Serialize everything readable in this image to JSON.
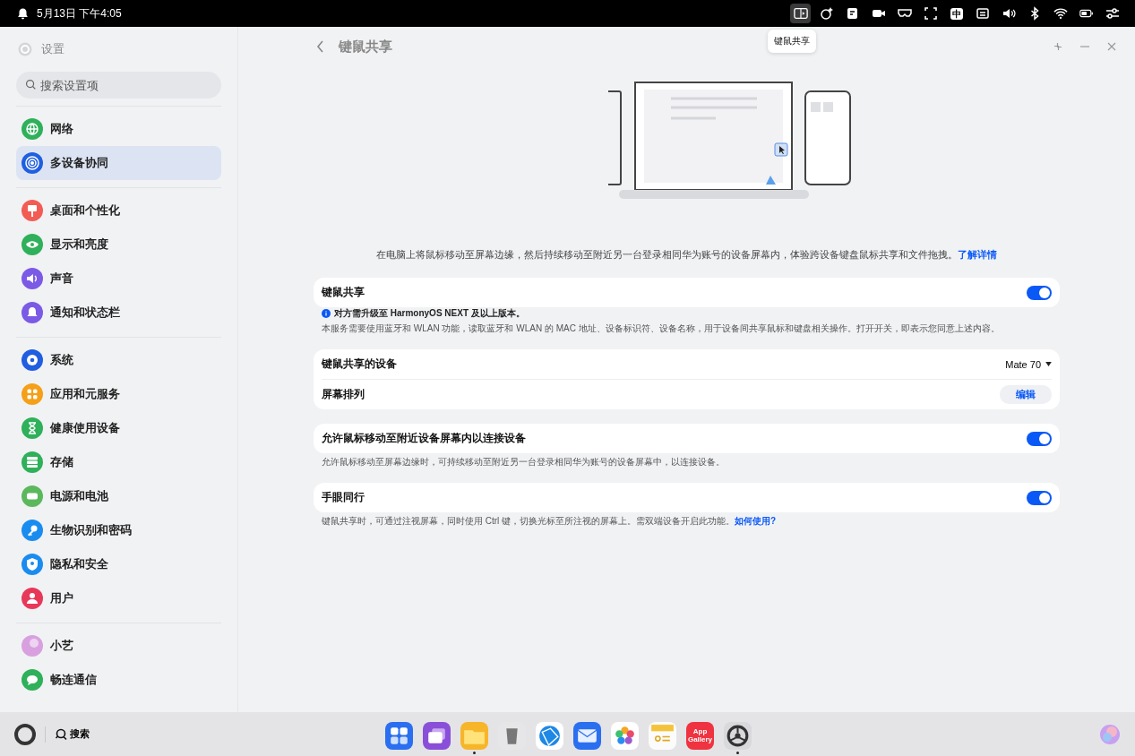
{
  "status_bar": {
    "date_time": "5月13日 下午4:05",
    "tray": [
      {
        "kind": "share",
        "selected": true
      },
      {
        "kind": "sparkle",
        "selected": false
      },
      {
        "kind": "note",
        "selected": false
      },
      {
        "kind": "camera",
        "selected": false
      },
      {
        "kind": "glasses",
        "selected": false
      },
      {
        "kind": "frame",
        "selected": false
      },
      {
        "kind": "ime",
        "label": "中",
        "selected": false
      },
      {
        "kind": "ticket",
        "selected": false
      },
      {
        "kind": "volume",
        "selected": false
      },
      {
        "kind": "bluetooth",
        "selected": false
      },
      {
        "kind": "wifi",
        "selected": false
      },
      {
        "kind": "battery",
        "selected": false
      },
      {
        "kind": "sliders",
        "selected": false
      }
    ],
    "tooltip": "键鼠共享"
  },
  "sidebar": {
    "title": "设置",
    "search": {
      "placeholder": "搜索设置项"
    },
    "groups": [
      {
        "items": [
          {
            "label": "网络",
            "kind": "globe",
            "color": "#2fb05a",
            "selected": false
          },
          {
            "label": "多设备协同",
            "kind": "rings",
            "color": "#1f5fe0",
            "selected": true
          }
        ]
      },
      {
        "items": [
          {
            "label": "桌面和个性化",
            "kind": "brush",
            "color": "#f25c54",
            "selected": false
          },
          {
            "label": "显示和亮度",
            "kind": "eye",
            "color": "#2fb05a",
            "selected": false
          },
          {
            "label": "声音",
            "kind": "speaker",
            "color": "#7b5ae6",
            "selected": false
          },
          {
            "label": "通知和状态栏",
            "kind": "bell",
            "color": "#7b5ae6",
            "selected": false
          }
        ]
      },
      {
        "items": [
          {
            "label": "系统",
            "kind": "gear",
            "color": "#1f5fe0",
            "selected": false
          },
          {
            "label": "应用和元服务",
            "kind": "grid",
            "color": "#f5a019",
            "selected": false
          },
          {
            "label": "健康使用设备",
            "kind": "hourglass",
            "color": "#2fb05a",
            "selected": false
          },
          {
            "label": "存储",
            "kind": "stack",
            "color": "#2fb05a",
            "selected": false
          },
          {
            "label": "电源和电池",
            "kind": "battery",
            "color": "#5cb85c",
            "selected": false
          },
          {
            "label": "生物识别和密码",
            "kind": "key",
            "color": "#1a8cf0",
            "selected": false
          },
          {
            "label": "隐私和安全",
            "kind": "shield",
            "color": "#1a8cf0",
            "selected": false
          },
          {
            "label": "用户",
            "kind": "person",
            "color": "#e8385a",
            "selected": false
          }
        ]
      },
      {
        "items": [
          {
            "label": "小艺",
            "kind": "orb",
            "color": "#d9a0e0",
            "selected": false
          },
          {
            "label": "畅连通信",
            "kind": "chat",
            "color": "#2fb05a",
            "selected": false
          }
        ]
      }
    ]
  },
  "page": {
    "title": "键鼠共享",
    "description": {
      "text": "在电脑上将鼠标移动至屏幕边缘，然后持续移动至附近另一台登录相同华为账号的设备屏幕内，体验跨设备键盘鼠标共享和文件拖拽。",
      "link": "了解详情"
    },
    "cards": [
      {
        "rows": [
          {
            "kind": "toggle",
            "label": "键鼠共享",
            "on": true
          }
        ],
        "notes": [
          {
            "kind": "info",
            "text": "对方需升级至 HarmonyOS NEXT 及以上版本。"
          },
          {
            "kind": "plain",
            "text": "本服务需要使用蓝牙和 WLAN 功能，读取蓝牙和 WLAN 的 MAC 地址、设备标识符、设备名称，用于设备间共享鼠标和键盘相关操作。打开开关，即表示您同意上述内容。"
          }
        ]
      },
      {
        "rows": [
          {
            "kind": "dropdown",
            "label": "键鼠共享的设备",
            "value": "Mate 70"
          },
          {
            "kind": "button",
            "label": "屏幕排列",
            "button": "编辑"
          }
        ]
      },
      {
        "rows": [
          {
            "kind": "toggle",
            "label": "允许鼠标移动至附近设备屏幕内以连接设备",
            "on": true
          }
        ],
        "notes": [
          {
            "kind": "plain",
            "text": "允许鼠标移动至屏幕边缘时，可持续移动至附近另一台登录相同华为账号的设备屏幕中，以连接设备。"
          }
        ]
      },
      {
        "rows": [
          {
            "kind": "toggle",
            "label": "手眼同行",
            "on": true
          }
        ],
        "notes": [
          {
            "kind": "plain",
            "text": "键鼠共享时，可通过注视屏幕，同时使用 Ctrl 键，切换光标至所注视的屏幕上。需双端设备开启此功能。",
            "link": "如何使用?"
          }
        ]
      }
    ]
  },
  "dock": {
    "search": "搜索",
    "apps": [
      {
        "kind": "launcher",
        "running": false
      },
      {
        "kind": "tasks",
        "running": false
      },
      {
        "kind": "files",
        "running": true
      },
      {
        "kind": "trash",
        "running": false
      },
      {
        "kind": "browser",
        "running": false
      },
      {
        "kind": "mail",
        "running": false
      },
      {
        "kind": "photos",
        "running": false
      },
      {
        "kind": "notes",
        "running": false
      },
      {
        "kind": "store",
        "label": "App Gallery",
        "running": false
      },
      {
        "kind": "settings",
        "running": true
      }
    ]
  }
}
